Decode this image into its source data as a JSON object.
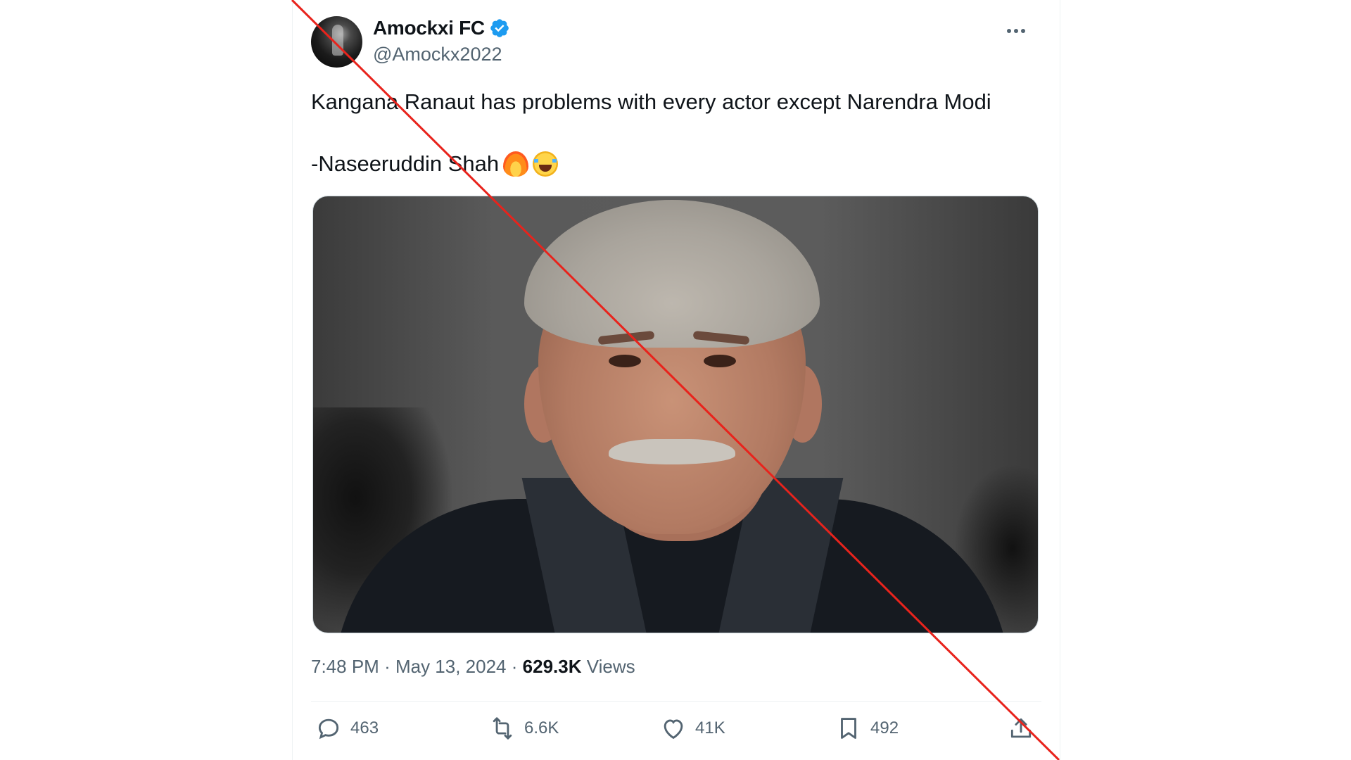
{
  "tweet": {
    "author": {
      "display_name": "Amockxi FC",
      "handle": "@Amockx2022",
      "verified_color": "#1d9bf0"
    },
    "text_line1": "Kangana Ranaut has problems with every actor except Narendra Modi",
    "text_line2": "-Naseeruddin Shah",
    "emojis": [
      "fire",
      "face-with-tears-of-joy"
    ],
    "media": {
      "kind": "photo"
    },
    "meta": {
      "time": "7:48 PM",
      "date": "May 13, 2024",
      "separator": "·",
      "views_count": "629.3K",
      "views_label": "Views"
    },
    "actions": {
      "replies": "463",
      "reposts": "6.6K",
      "likes": "41K",
      "bookmarks": "492"
    }
  },
  "overlay": {
    "strike_color": "#e8231c"
  }
}
